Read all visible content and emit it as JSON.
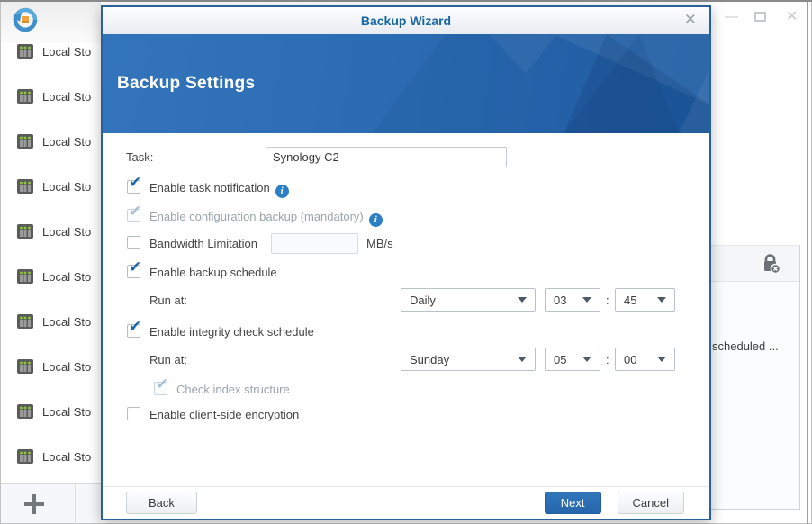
{
  "app": {
    "window_controls": {
      "minimize_icon": "—",
      "close_icon": "✕"
    },
    "sidebar": {
      "items": [
        {
          "label": "Local Sto"
        },
        {
          "label": "Local Sto"
        },
        {
          "label": "Local Sto"
        },
        {
          "label": "Local Sto"
        },
        {
          "label": "Local Sto"
        },
        {
          "label": "Local Sto"
        },
        {
          "label": "Local Sto"
        },
        {
          "label": "Local Sto"
        },
        {
          "label": "Local Sto"
        },
        {
          "label": "Local Sto"
        }
      ]
    },
    "right_panel": {
      "header_icon": "lock-remove-icon",
      "partial_text": "scheduled ..."
    }
  },
  "dialog": {
    "title": "Backup Wizard",
    "close_icon": "✕",
    "banner_title": "Backup Settings",
    "form": {
      "task_label": "Task:",
      "task_value": "Synology C2",
      "enable_task_notification": "Enable task notification",
      "enable_config_backup": "Enable configuration backup (mandatory)",
      "bandwidth_limitation": "Bandwidth Limitation",
      "bandwidth_value": "",
      "bandwidth_unit": "MB/s",
      "enable_backup_schedule": "Enable backup schedule",
      "run_at_label": "Run at:",
      "colon": ":",
      "backup_schedule": {
        "frequency": "Daily",
        "hour": "03",
        "minute": "45"
      },
      "enable_integrity_schedule": "Enable integrity check schedule",
      "integrity_schedule": {
        "frequency": "Sunday",
        "hour": "05",
        "minute": "00"
      },
      "check_index_structure": "Check index structure",
      "enable_client_side_encryption": "Enable client-side encryption"
    },
    "footer": {
      "back": "Back",
      "next": "Next",
      "cancel": "Cancel"
    }
  },
  "colors": {
    "dialog_border": "#29619f",
    "title_text": "#17669f",
    "banner_blue": "#2a6ab1",
    "next_button": "#2b6fb3",
    "check_blue": "#2065a9",
    "info_icon": "#2d7fc3"
  }
}
